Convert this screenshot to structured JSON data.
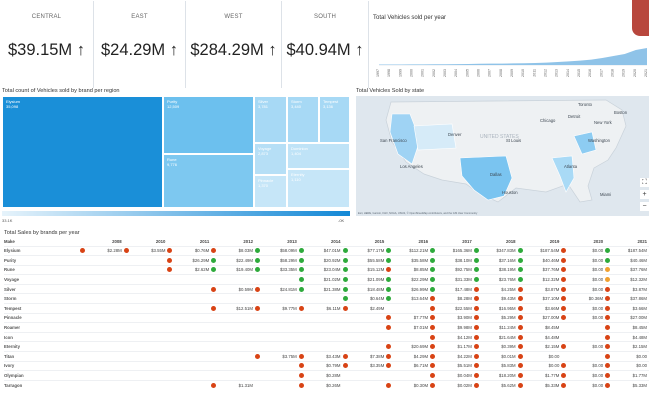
{
  "kpis": [
    {
      "label": "CENTRAL",
      "value": "$39.15M ↑"
    },
    {
      "label": "EAST",
      "value": "$24.29M ↑"
    },
    {
      "label": "WEST",
      "value": "$284.29M ↑"
    },
    {
      "label": "SOUTH",
      "value": "$40.94M ↑"
    }
  ],
  "vehicles_chart": {
    "title": "Total Vehicles sold per year",
    "years": [
      "1997",
      "1998",
      "1999",
      "2000",
      "2001",
      "2002",
      "2003",
      "2004",
      "2005",
      "2006",
      "2007",
      "2008",
      "2009",
      "2010",
      "2011",
      "2012",
      "2013",
      "2014",
      "2015",
      "2016",
      "2017",
      "2018",
      "2019",
      "2020",
      "2021"
    ],
    "area_color": "#8fc3e8"
  },
  "treemap": {
    "title": "Total count of Vehicles sold by brand per region",
    "cells": [
      {
        "label": "Elysium",
        "value": "35,098"
      },
      {
        "label": "Purity",
        "value": "12,509"
      },
      {
        "label": "Rune",
        "value": "9,776"
      },
      {
        "label": "Silver",
        "value": "3,781"
      },
      {
        "label": "Storm",
        "value": "3,440"
      },
      {
        "label": "Tempest",
        "value": "3,136"
      },
      {
        "label": "Voyage",
        "value": "2,873"
      },
      {
        "label": "Dominion",
        "value": "1,404"
      },
      {
        "label": "Eternity",
        "value": "1,110"
      },
      {
        "label": "Pinnacle",
        "value": "1,370"
      }
    ],
    "scale_min": "33.1K",
    "scale_max": "-0K",
    "colors": {
      "dark": "#1a8fd8",
      "mid": "#6cc0ee",
      "light": "#a7d9f5",
      "lighter": "#c6e6f8"
    }
  },
  "map": {
    "title": "Total Vehicles Sold by state",
    "country_label": "UNITED STATES",
    "cities": [
      {
        "name": "Toronto"
      },
      {
        "name": "Boston"
      },
      {
        "name": "Chicago"
      },
      {
        "name": "Detroit"
      },
      {
        "name": "New York"
      },
      {
        "name": "Washington"
      },
      {
        "name": "Denver"
      },
      {
        "name": "St Louis"
      },
      {
        "name": "San Francisco"
      },
      {
        "name": "Los Angeles"
      },
      {
        "name": "Atlanta"
      },
      {
        "name": "Dallas"
      },
      {
        "name": "Houston"
      },
      {
        "name": "Miami"
      }
    ],
    "attribution": "Esri, HERE, Garmin, FAO, NOAA, USGS, © OpenStreetMap contributors, and the GIS User Community",
    "controls": [
      "⛶",
      "+",
      "−"
    ]
  },
  "sales_table": {
    "title": "Total Sales by brands per year",
    "header_make": "Make",
    "years": [
      "2008",
      "2010",
      "2011",
      "2012",
      "2013",
      "2014",
      "2015",
      "2016",
      "2017",
      "2018",
      "2019",
      "2020",
      "2021"
    ],
    "legend_colors": {
      "red": "#d84315",
      "orange": "#f0a030",
      "green": "#2eaa3c"
    },
    "rows": [
      {
        "make": "Elysium",
        "cells": [
          {
            "c": "red",
            "v": "$2.28M"
          },
          {
            "c": "red",
            "v": "$3.55M"
          },
          {
            "c": "red",
            "v": "$0.76M"
          },
          {
            "c": "red",
            "v": "$8.03M"
          },
          {
            "c": "green",
            "v": "$58.09M"
          },
          {
            "c": "green",
            "v": "$47.01M"
          },
          {
            "c": "green",
            "v": "$77.17M"
          },
          {
            "c": "green",
            "v": "$112.21M"
          },
          {
            "c": "green",
            "v": "$165.36M"
          },
          {
            "c": "green",
            "v": "$347.83M"
          },
          {
            "c": "green",
            "v": "$187.54M"
          },
          {
            "c": "red",
            "v": "$0.00"
          },
          {
            "c": "green",
            "v": "$187.54M"
          }
        ]
      },
      {
        "make": "Purity",
        "cells": [
          {
            "c": "",
            "v": ""
          },
          {
            "c": "",
            "v": ""
          },
          {
            "c": "red",
            "v": "$26.29M"
          },
          {
            "c": "green",
            "v": "$22.49M"
          },
          {
            "c": "green",
            "v": "$58.29M"
          },
          {
            "c": "green",
            "v": "$20.92M"
          },
          {
            "c": "green",
            "v": "$55.58M"
          },
          {
            "c": "green",
            "v": "$35.58M"
          },
          {
            "c": "green",
            "v": "$38.10M"
          },
          {
            "c": "green",
            "v": "$37.16M"
          },
          {
            "c": "green",
            "v": "$40.46M"
          },
          {
            "c": "red",
            "v": "$0.00"
          },
          {
            "c": "green",
            "v": "$40.46M"
          }
        ]
      },
      {
        "make": "Rune",
        "cells": [
          {
            "c": "",
            "v": ""
          },
          {
            "c": "",
            "v": ""
          },
          {
            "c": "red",
            "v": "$2.62M"
          },
          {
            "c": "green",
            "v": "$19.40M"
          },
          {
            "c": "green",
            "v": "$33.35M"
          },
          {
            "c": "green",
            "v": "$23.04M"
          },
          {
            "c": "green",
            "v": "$15.12M"
          },
          {
            "c": "red",
            "v": "$8.85M"
          },
          {
            "c": "green",
            "v": "$92.75M"
          },
          {
            "c": "green",
            "v": "$38.19M"
          },
          {
            "c": "green",
            "v": "$37.76M"
          },
          {
            "c": "red",
            "v": "$0.00"
          },
          {
            "c": "orange",
            "v": "$37.76M"
          }
        ]
      },
      {
        "make": "Voyage",
        "cells": [
          {
            "c": "",
            "v": ""
          },
          {
            "c": "",
            "v": ""
          },
          {
            "c": "",
            "v": ""
          },
          {
            "c": "",
            "v": ""
          },
          {
            "c": "",
            "v": ""
          },
          {
            "c": "green",
            "v": "$21.02M"
          },
          {
            "c": "green",
            "v": "$21.09M"
          },
          {
            "c": "green",
            "v": "$22.29M"
          },
          {
            "c": "green",
            "v": "$31.33M"
          },
          {
            "c": "green",
            "v": "$23.76M"
          },
          {
            "c": "green",
            "v": "$12.32M"
          },
          {
            "c": "red",
            "v": "$0.00"
          },
          {
            "c": "orange",
            "v": "$12.32M"
          }
        ]
      },
      {
        "make": "Silver",
        "cells": [
          {
            "c": "",
            "v": ""
          },
          {
            "c": "",
            "v": ""
          },
          {
            "c": "",
            "v": ""
          },
          {
            "c": "red",
            "v": "$0.59M"
          },
          {
            "c": "red",
            "v": "$24.81M"
          },
          {
            "c": "green",
            "v": "$21.38M"
          },
          {
            "c": "green",
            "v": "$18.48M"
          },
          {
            "c": "green",
            "v": "$26.99M"
          },
          {
            "c": "green",
            "v": "$17.48M"
          },
          {
            "c": "red",
            "v": "$4.25M"
          },
          {
            "c": "red",
            "v": "$3.87M"
          },
          {
            "c": "red",
            "v": "$0.00"
          },
          {
            "c": "red",
            "v": "$3.87M"
          }
        ]
      },
      {
        "make": "Storm",
        "cells": [
          {
            "c": "",
            "v": ""
          },
          {
            "c": "",
            "v": ""
          },
          {
            "c": "",
            "v": ""
          },
          {
            "c": "",
            "v": ""
          },
          {
            "c": "",
            "v": ""
          },
          {
            "c": "",
            "v": ""
          },
          {
            "c": "green",
            "v": "$0.64M"
          },
          {
            "c": "green",
            "v": "$13.64M"
          },
          {
            "c": "red",
            "v": "$8.28M"
          },
          {
            "c": "red",
            "v": "$9.43M"
          },
          {
            "c": "red",
            "v": "$37.10M"
          },
          {
            "c": "red",
            "v": "$0.36M"
          },
          {
            "c": "red",
            "v": "$37.86M"
          }
        ]
      },
      {
        "make": "Tempest",
        "cells": [
          {
            "c": "",
            "v": ""
          },
          {
            "c": "",
            "v": ""
          },
          {
            "c": "",
            "v": ""
          },
          {
            "c": "red",
            "v": "$12.51M"
          },
          {
            "c": "red",
            "v": "$9.77M"
          },
          {
            "c": "red",
            "v": "$6.11M"
          },
          {
            "c": "red",
            "v": "$2.49M"
          },
          {
            "c": "",
            "v": ""
          },
          {
            "c": "red",
            "v": "$22.55M"
          },
          {
            "c": "red",
            "v": "$16.95M"
          },
          {
            "c": "red",
            "v": "$3.66M"
          },
          {
            "c": "red",
            "v": "$0.00"
          },
          {
            "c": "red",
            "v": "$3.66M"
          }
        ]
      },
      {
        "make": "Pinnacle",
        "cells": [
          {
            "c": "",
            "v": ""
          },
          {
            "c": "",
            "v": ""
          },
          {
            "c": "",
            "v": ""
          },
          {
            "c": "",
            "v": ""
          },
          {
            "c": "",
            "v": ""
          },
          {
            "c": "",
            "v": ""
          },
          {
            "c": "",
            "v": ""
          },
          {
            "c": "red",
            "v": "$7.77M"
          },
          {
            "c": "red",
            "v": "$3.90M"
          },
          {
            "c": "red",
            "v": "$5.29M"
          },
          {
            "c": "red",
            "v": "$27.00M"
          },
          {
            "c": "red",
            "v": "$0.00"
          },
          {
            "c": "red",
            "v": "$27.00M"
          }
        ]
      },
      {
        "make": "Roamer",
        "cells": [
          {
            "c": "",
            "v": ""
          },
          {
            "c": "",
            "v": ""
          },
          {
            "c": "",
            "v": ""
          },
          {
            "c": "",
            "v": ""
          },
          {
            "c": "",
            "v": ""
          },
          {
            "c": "",
            "v": ""
          },
          {
            "c": "",
            "v": ""
          },
          {
            "c": "red",
            "v": "$7.01M"
          },
          {
            "c": "red",
            "v": "$9.98M"
          },
          {
            "c": "red",
            "v": "$11.24M"
          },
          {
            "c": "red",
            "v": "$8.45M"
          },
          {
            "c": "",
            "v": ""
          },
          {
            "c": "red",
            "v": "$8.45M"
          }
        ]
      },
      {
        "make": "Icon",
        "cells": [
          {
            "c": "",
            "v": ""
          },
          {
            "c": "",
            "v": ""
          },
          {
            "c": "",
            "v": ""
          },
          {
            "c": "",
            "v": ""
          },
          {
            "c": "",
            "v": ""
          },
          {
            "c": "",
            "v": ""
          },
          {
            "c": "",
            "v": ""
          },
          {
            "c": "",
            "v": ""
          },
          {
            "c": "red",
            "v": "$4.12M"
          },
          {
            "c": "red",
            "v": "$21.64M"
          },
          {
            "c": "red",
            "v": "$4.48M"
          },
          {
            "c": "",
            "v": ""
          },
          {
            "c": "red",
            "v": "$4.48M"
          }
        ]
      },
      {
        "make": "Eternity",
        "cells": [
          {
            "c": "",
            "v": ""
          },
          {
            "c": "",
            "v": ""
          },
          {
            "c": "",
            "v": ""
          },
          {
            "c": "",
            "v": ""
          },
          {
            "c": "",
            "v": ""
          },
          {
            "c": "",
            "v": ""
          },
          {
            "c": "",
            "v": ""
          },
          {
            "c": "red",
            "v": "$20.69M"
          },
          {
            "c": "red",
            "v": "$1.17M"
          },
          {
            "c": "red",
            "v": "$0.39M"
          },
          {
            "c": "red",
            "v": "$2.15M"
          },
          {
            "c": "red",
            "v": "$0.00"
          },
          {
            "c": "red",
            "v": "$2.15M"
          }
        ]
      },
      {
        "make": "Titan",
        "cells": [
          {
            "c": "",
            "v": ""
          },
          {
            "c": "",
            "v": ""
          },
          {
            "c": "",
            "v": ""
          },
          {
            "c": "",
            "v": ""
          },
          {
            "c": "red",
            "v": "$3.75M"
          },
          {
            "c": "red",
            "v": "$3.43M"
          },
          {
            "c": "red",
            "v": "$7.38M"
          },
          {
            "c": "red",
            "v": "$4.29M"
          },
          {
            "c": "red",
            "v": "$4.22M"
          },
          {
            "c": "red",
            "v": "$0.01M"
          },
          {
            "c": "red",
            "v": "$0.00"
          },
          {
            "c": "",
            "v": ""
          },
          {
            "c": "red",
            "v": "$0.00"
          }
        ]
      },
      {
        "make": "Ivory",
        "cells": [
          {
            "c": "",
            "v": ""
          },
          {
            "c": "",
            "v": ""
          },
          {
            "c": "",
            "v": ""
          },
          {
            "c": "",
            "v": ""
          },
          {
            "c": "",
            "v": ""
          },
          {
            "c": "red",
            "v": "$0.79M"
          },
          {
            "c": "red",
            "v": "$3.35M"
          },
          {
            "c": "red",
            "v": "$6.71M"
          },
          {
            "c": "red",
            "v": "$5.51M"
          },
          {
            "c": "red",
            "v": "$5.83M"
          },
          {
            "c": "red",
            "v": "$0.00"
          },
          {
            "c": "red",
            "v": "$0.00"
          },
          {
            "c": "red",
            "v": "$0.00"
          }
        ]
      },
      {
        "make": "Olympian",
        "cells": [
          {
            "c": "",
            "v": ""
          },
          {
            "c": "",
            "v": ""
          },
          {
            "c": "",
            "v": ""
          },
          {
            "c": "",
            "v": ""
          },
          {
            "c": "",
            "v": ""
          },
          {
            "c": "red",
            "v": "$0.28M"
          },
          {
            "c": "",
            "v": ""
          },
          {
            "c": "",
            "v": ""
          },
          {
            "c": "red",
            "v": "$0.04M"
          },
          {
            "c": "red",
            "v": "$18.20M"
          },
          {
            "c": "red",
            "v": "$1.77M"
          },
          {
            "c": "red",
            "v": "$0.00"
          },
          {
            "c": "red",
            "v": "$1.77M"
          }
        ]
      },
      {
        "make": "Tarragon",
        "cells": [
          {
            "c": "",
            "v": ""
          },
          {
            "c": "",
            "v": ""
          },
          {
            "c": "",
            "v": ""
          },
          {
            "c": "red",
            "v": "$1.31M"
          },
          {
            "c": "",
            "v": ""
          },
          {
            "c": "red",
            "v": "$0.26M"
          },
          {
            "c": "",
            "v": ""
          },
          {
            "c": "red",
            "v": "$0.30M"
          },
          {
            "c": "red",
            "v": "$0.02M"
          },
          {
            "c": "red",
            "v": "$5.62M"
          },
          {
            "c": "red",
            "v": "$5.33M"
          },
          {
            "c": "red",
            "v": "$0.00"
          },
          {
            "c": "red",
            "v": "$5.33M"
          }
        ]
      }
    ]
  }
}
